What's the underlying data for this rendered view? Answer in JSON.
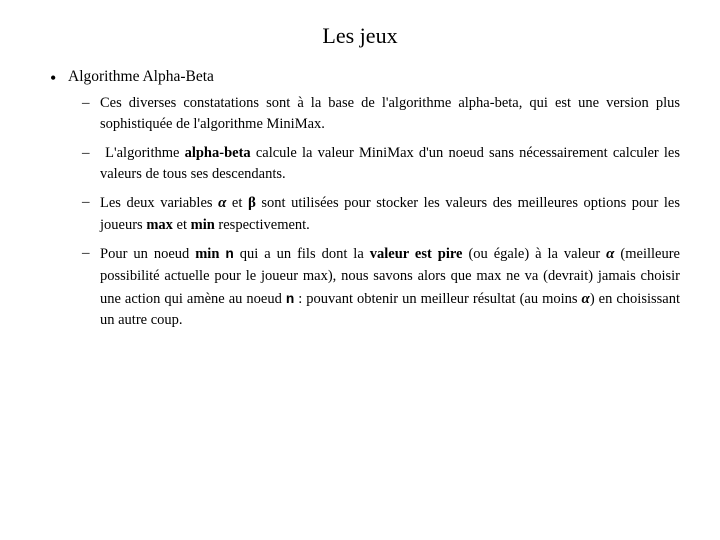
{
  "title": "Les jeux",
  "main_bullet": {
    "symbol": "•",
    "label": "Algorithme Alpha-Beta"
  },
  "sub_items": [
    {
      "id": "item1",
      "text_parts": [
        {
          "type": "normal",
          "text": "Ces diverses constatations sont à la base de l'algorithme alpha-beta, qui est une version plus sophistiquée de l'algorithme MiniMax."
        }
      ]
    },
    {
      "id": "item2",
      "text_parts": [
        {
          "type": "normal",
          "text": " L'algorithme "
        },
        {
          "type": "bold",
          "text": "alpha-beta"
        },
        {
          "type": "normal",
          "text": " calcule la valeur MiniMax d'un noeud sans nécessairement calculer les valeurs de tous ses descendants."
        }
      ]
    },
    {
      "id": "item3",
      "text_parts": [
        {
          "type": "normal",
          "text": "Les deux variables "
        },
        {
          "type": "alpha",
          "text": "α"
        },
        {
          "type": "normal",
          "text": " et "
        },
        {
          "type": "beta",
          "text": "β"
        },
        {
          "type": "normal",
          "text": " sont utilisées pour stocker les valeurs des meilleures "
        },
        {
          "type": "normal",
          "text": "options"
        },
        {
          "type": "normal",
          "text": " pour les joueurs "
        },
        {
          "type": "bold",
          "text": "max"
        },
        {
          "type": "normal",
          "text": " et "
        },
        {
          "type": "bold",
          "text": "min"
        },
        {
          "type": "normal",
          "text": " respectivement."
        }
      ]
    },
    {
      "id": "item4",
      "text_parts": [
        {
          "type": "normal",
          "text": "Pour un noeud "
        },
        {
          "type": "bold",
          "text": "min"
        },
        {
          "type": "normal",
          "text": " "
        },
        {
          "type": "bold-mono",
          "text": "n"
        },
        {
          "type": "normal",
          "text": " qui a un fils dont la "
        },
        {
          "type": "bold",
          "text": "valeur est pire"
        },
        {
          "type": "normal",
          "text": " (ou égale) à la valeur "
        },
        {
          "type": "alpha",
          "text": "α"
        },
        {
          "type": "normal",
          "text": " (meilleure possibilité actuelle pour le joueur max), nous savons alors que max ne va (devrait) jamais choisir une action qui amène au noeud "
        },
        {
          "type": "bold-mono",
          "text": "n"
        },
        {
          "type": "normal",
          "text": " : pouvant obtenir un meilleur résultat (au moins "
        },
        {
          "type": "alpha",
          "text": "α"
        },
        {
          "type": "normal",
          "text": ") en choisissant un autre coup."
        }
      ]
    }
  ]
}
